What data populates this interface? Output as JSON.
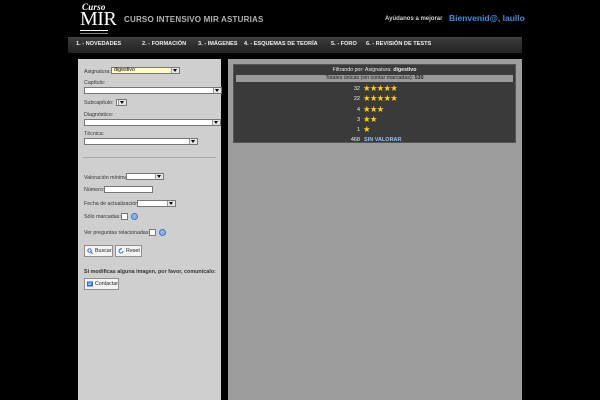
{
  "header": {
    "logo_small": "Curso",
    "logo_big": "MIR",
    "site_title": "CURSO INTENSIVO MIR ASTURIAS",
    "help_link": "Ayúdanos a mejorar",
    "welcome": "Bienvenid@, laullo",
    "accent_color": "#3f8fe0"
  },
  "nav": [
    "1. - NOVEDADES",
    "2. - FORMACIÓN",
    "3. - IMÁGENES",
    "4. - ESQUEMAS DE TEORÍA",
    "5. - FORO",
    "6. - REVISIÓN DE TESTS"
  ],
  "filters": {
    "asignatura_label": "Asignatura:",
    "asignatura_value": "digestivo",
    "capitulo_label": "Capítulo:",
    "subcapitulo_label": "Subcapítulo:",
    "diagnostico_label": "Diagnóstico:",
    "tecnica_label": "Técnica:",
    "valoracion_label": "Valoración mínima:",
    "numero_label": "Número:",
    "fecha_label": "Fecha de actualización:",
    "solo_marcadas_label": "Sólo marcadas:",
    "ver_preguntas_label": "Ver preguntas relacionadas:",
    "buscar_label": "Buscar",
    "reset_label": "Reset",
    "note": "Si modificas alguna imagen, por favor, comunícalo:",
    "contactar_label": "Contactar"
  },
  "results": {
    "filter_prefix": "Filtrando por: Asignatura:",
    "filter_value": "digestivo",
    "totals_label": "Totales únicas (sin contar marcadas):",
    "totals_value": "530",
    "ratings": [
      {
        "count": "32",
        "stars": 5
      },
      {
        "count": "22",
        "stars": 5
      },
      {
        "count": "4",
        "stars": 3
      },
      {
        "count": "3",
        "stars": 2
      },
      {
        "count": "1",
        "stars": 1
      }
    ],
    "unrated_count": "468",
    "unrated_label": "SIN VALORAR",
    "star_color": "#ffcc1a"
  }
}
